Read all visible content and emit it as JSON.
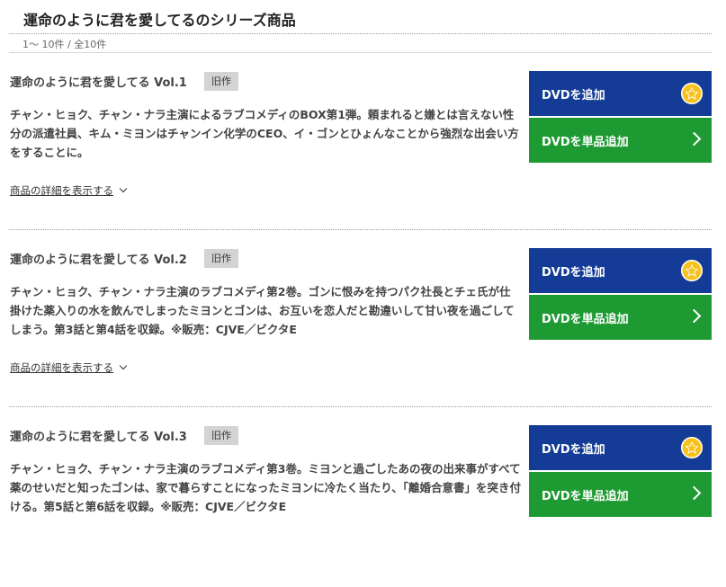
{
  "header": {
    "title": "運命のように君を愛してるのシリーズ商品",
    "count": "1〜 10件 / 全10件"
  },
  "buttons": {
    "add_label": "DVDを追加",
    "single_label": "DVDを単品追加"
  },
  "detail_link_label": "商品の詳細を表示する",
  "items": [
    {
      "title": "運命のように君を愛してる Vol.1",
      "badge": "旧作",
      "desc": "チャン・ヒョク、チャン・ナラ主演によるラブコメディのBOX第1弾。頼まれると嫌とは言えない性分の派遣社員、キム・ミヨンはチャンイン化学のCEO、イ・ゴンとひょんなことから強烈な出会い方をすることに。"
    },
    {
      "title": "運命のように君を愛してる Vol.2",
      "badge": "旧作",
      "desc": "チャン・ヒョク、チャン・ナラ主演のラブコメディ第2巻。ゴンに恨みを持つパク社長とチェ氏が仕掛けた薬入りの水を飲んでしまったミヨンとゴンは、お互いを恋人だと勘違いして甘い夜を過ごしてしまう。第3話と第4話を収録。※販売：CJVE／ビクタE"
    },
    {
      "title": "運命のように君を愛してる Vol.3",
      "badge": "旧作",
      "desc": "チャン・ヒョク、チャン・ナラ主演のラブコメディ第3巻。ミヨンと過ごしたあの夜の出来事がすべて薬のせいだと知ったゴンは、家で暮らすことになったミヨンに冷たく当たり、「離婚合意書」を突き付ける。第5話と第6話を収録。※販売：CJVE／ビクタE"
    }
  ],
  "colors": {
    "add_button": "#143c96",
    "single_button": "#1e9a32",
    "star": "#f7c21c",
    "badge": "#d3d3d3"
  },
  "icons": {
    "add": "star-icon",
    "single": "chevron-right-icon",
    "detail": "chevron-down-icon"
  }
}
